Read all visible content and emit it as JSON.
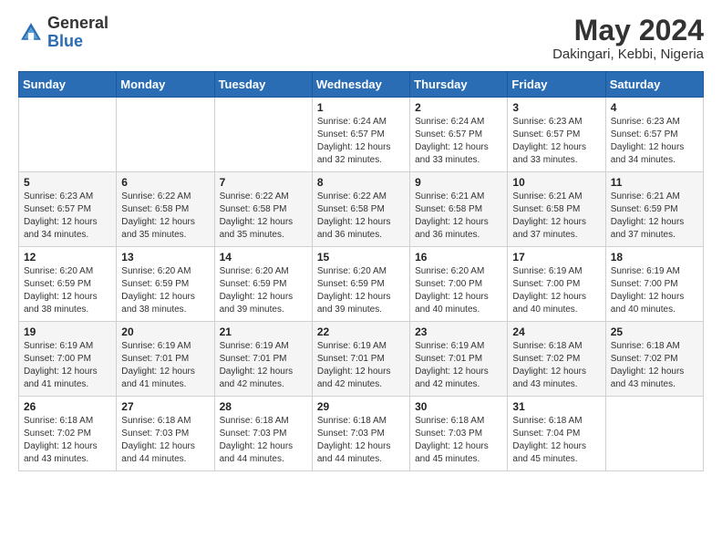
{
  "header": {
    "logo_line1": "General",
    "logo_line2": "Blue",
    "title": "May 2024",
    "subtitle": "Dakingari, Kebbi, Nigeria"
  },
  "days_of_week": [
    "Sunday",
    "Monday",
    "Tuesday",
    "Wednesday",
    "Thursday",
    "Friday",
    "Saturday"
  ],
  "weeks": [
    [
      {
        "day": "",
        "info": ""
      },
      {
        "day": "",
        "info": ""
      },
      {
        "day": "",
        "info": ""
      },
      {
        "day": "1",
        "info": "Sunrise: 6:24 AM\nSunset: 6:57 PM\nDaylight: 12 hours\nand 32 minutes."
      },
      {
        "day": "2",
        "info": "Sunrise: 6:24 AM\nSunset: 6:57 PM\nDaylight: 12 hours\nand 33 minutes."
      },
      {
        "day": "3",
        "info": "Sunrise: 6:23 AM\nSunset: 6:57 PM\nDaylight: 12 hours\nand 33 minutes."
      },
      {
        "day": "4",
        "info": "Sunrise: 6:23 AM\nSunset: 6:57 PM\nDaylight: 12 hours\nand 34 minutes."
      }
    ],
    [
      {
        "day": "5",
        "info": "Sunrise: 6:23 AM\nSunset: 6:57 PM\nDaylight: 12 hours\nand 34 minutes."
      },
      {
        "day": "6",
        "info": "Sunrise: 6:22 AM\nSunset: 6:58 PM\nDaylight: 12 hours\nand 35 minutes."
      },
      {
        "day": "7",
        "info": "Sunrise: 6:22 AM\nSunset: 6:58 PM\nDaylight: 12 hours\nand 35 minutes."
      },
      {
        "day": "8",
        "info": "Sunrise: 6:22 AM\nSunset: 6:58 PM\nDaylight: 12 hours\nand 36 minutes."
      },
      {
        "day": "9",
        "info": "Sunrise: 6:21 AM\nSunset: 6:58 PM\nDaylight: 12 hours\nand 36 minutes."
      },
      {
        "day": "10",
        "info": "Sunrise: 6:21 AM\nSunset: 6:58 PM\nDaylight: 12 hours\nand 37 minutes."
      },
      {
        "day": "11",
        "info": "Sunrise: 6:21 AM\nSunset: 6:59 PM\nDaylight: 12 hours\nand 37 minutes."
      }
    ],
    [
      {
        "day": "12",
        "info": "Sunrise: 6:20 AM\nSunset: 6:59 PM\nDaylight: 12 hours\nand 38 minutes."
      },
      {
        "day": "13",
        "info": "Sunrise: 6:20 AM\nSunset: 6:59 PM\nDaylight: 12 hours\nand 38 minutes."
      },
      {
        "day": "14",
        "info": "Sunrise: 6:20 AM\nSunset: 6:59 PM\nDaylight: 12 hours\nand 39 minutes."
      },
      {
        "day": "15",
        "info": "Sunrise: 6:20 AM\nSunset: 6:59 PM\nDaylight: 12 hours\nand 39 minutes."
      },
      {
        "day": "16",
        "info": "Sunrise: 6:20 AM\nSunset: 7:00 PM\nDaylight: 12 hours\nand 40 minutes."
      },
      {
        "day": "17",
        "info": "Sunrise: 6:19 AM\nSunset: 7:00 PM\nDaylight: 12 hours\nand 40 minutes."
      },
      {
        "day": "18",
        "info": "Sunrise: 6:19 AM\nSunset: 7:00 PM\nDaylight: 12 hours\nand 40 minutes."
      }
    ],
    [
      {
        "day": "19",
        "info": "Sunrise: 6:19 AM\nSunset: 7:00 PM\nDaylight: 12 hours\nand 41 minutes."
      },
      {
        "day": "20",
        "info": "Sunrise: 6:19 AM\nSunset: 7:01 PM\nDaylight: 12 hours\nand 41 minutes."
      },
      {
        "day": "21",
        "info": "Sunrise: 6:19 AM\nSunset: 7:01 PM\nDaylight: 12 hours\nand 42 minutes."
      },
      {
        "day": "22",
        "info": "Sunrise: 6:19 AM\nSunset: 7:01 PM\nDaylight: 12 hours\nand 42 minutes."
      },
      {
        "day": "23",
        "info": "Sunrise: 6:19 AM\nSunset: 7:01 PM\nDaylight: 12 hours\nand 42 minutes."
      },
      {
        "day": "24",
        "info": "Sunrise: 6:18 AM\nSunset: 7:02 PM\nDaylight: 12 hours\nand 43 minutes."
      },
      {
        "day": "25",
        "info": "Sunrise: 6:18 AM\nSunset: 7:02 PM\nDaylight: 12 hours\nand 43 minutes."
      }
    ],
    [
      {
        "day": "26",
        "info": "Sunrise: 6:18 AM\nSunset: 7:02 PM\nDaylight: 12 hours\nand 43 minutes."
      },
      {
        "day": "27",
        "info": "Sunrise: 6:18 AM\nSunset: 7:03 PM\nDaylight: 12 hours\nand 44 minutes."
      },
      {
        "day": "28",
        "info": "Sunrise: 6:18 AM\nSunset: 7:03 PM\nDaylight: 12 hours\nand 44 minutes."
      },
      {
        "day": "29",
        "info": "Sunrise: 6:18 AM\nSunset: 7:03 PM\nDaylight: 12 hours\nand 44 minutes."
      },
      {
        "day": "30",
        "info": "Sunrise: 6:18 AM\nSunset: 7:03 PM\nDaylight: 12 hours\nand 45 minutes."
      },
      {
        "day": "31",
        "info": "Sunrise: 6:18 AM\nSunset: 7:04 PM\nDaylight: 12 hours\nand 45 minutes."
      },
      {
        "day": "",
        "info": ""
      }
    ]
  ]
}
